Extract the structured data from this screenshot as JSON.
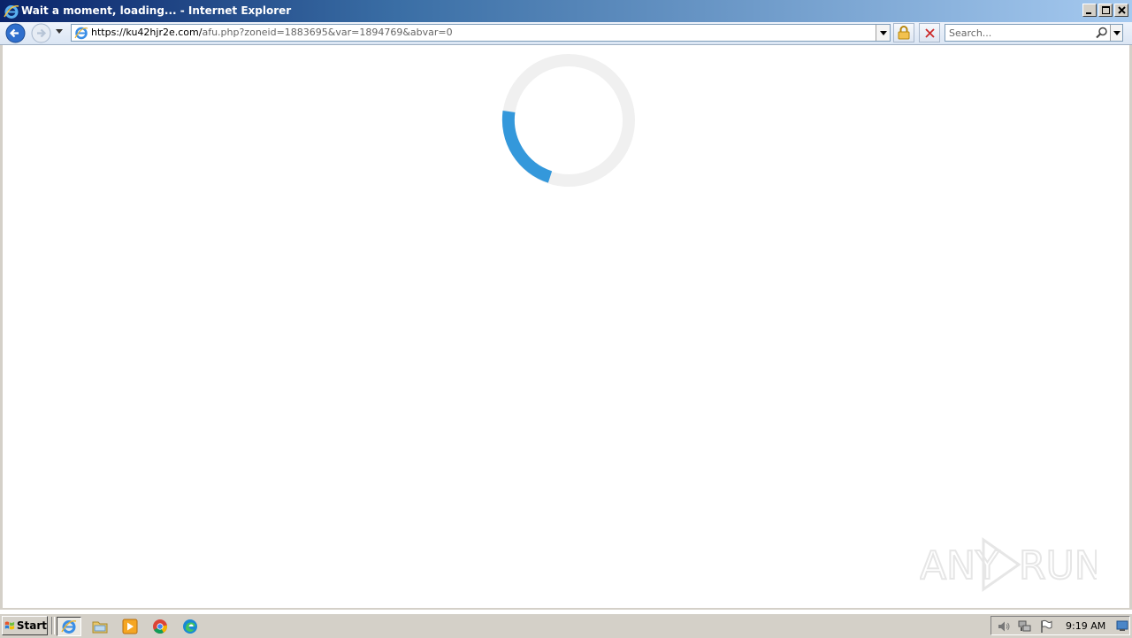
{
  "window": {
    "title": "Wait a moment, loading... - Internet Explorer"
  },
  "address_bar": {
    "url_domain": "https://ku42hjr2e.com/",
    "url_path": "afu.php?zoneid=1883695&var=1894769&abvar=0"
  },
  "search": {
    "placeholder": "Search..."
  },
  "spinner": {
    "track_color": "#f0f0f0",
    "arc_color": "#3498db"
  },
  "watermark": {
    "text_left": "ANY",
    "text_right": "RUN"
  },
  "taskbar": {
    "start_label": "Start",
    "clock": "9:19 AM",
    "pinned_icons": [
      "ie-icon",
      "folder-icon",
      "media-player-icon",
      "chrome-icon",
      "edge-icon"
    ]
  }
}
